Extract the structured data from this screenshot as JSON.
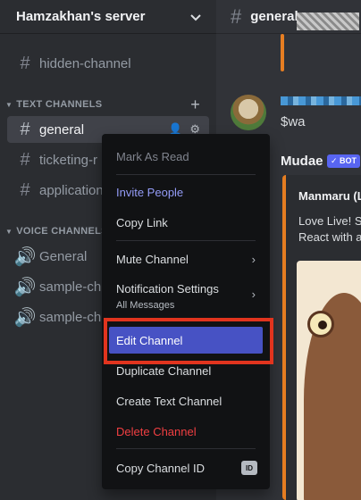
{
  "server": {
    "name": "Hamzakhan's server"
  },
  "sidebar": {
    "hidden_channel": "hidden-channel",
    "text_category": "TEXT CHANNELS",
    "text_channels": [
      "general",
      "ticketing-r",
      "application"
    ],
    "voice_category": "VOICE CHANNELS",
    "voice_channels": [
      "General",
      "sample-ch",
      "sample-ch"
    ]
  },
  "main": {
    "channel_title": "general",
    "message_text": "$wa",
    "mudae_name": "Mudae",
    "bot_badge": "✓ BOT",
    "embed_title": "Manmaru (L",
    "embed_line1": "Love Live! Su",
    "embed_line2": "React with a"
  },
  "context_menu": {
    "mark_as_read": "Mark As Read",
    "invite_people": "Invite People",
    "copy_link": "Copy Link",
    "mute_channel": "Mute Channel",
    "notification_settings": "Notification Settings",
    "notification_sub": "All Messages",
    "edit_channel": "Edit Channel",
    "duplicate_channel": "Duplicate Channel",
    "create_text_channel": "Create Text Channel",
    "delete_channel": "Delete Channel",
    "copy_channel_id": "Copy Channel ID",
    "id_badge": "ID"
  },
  "colors": {
    "accent": "#949cf7",
    "danger": "#f23f42",
    "selected": "#4752c4",
    "highlight": "#e1341e",
    "embed_bar": "#e67e22"
  }
}
